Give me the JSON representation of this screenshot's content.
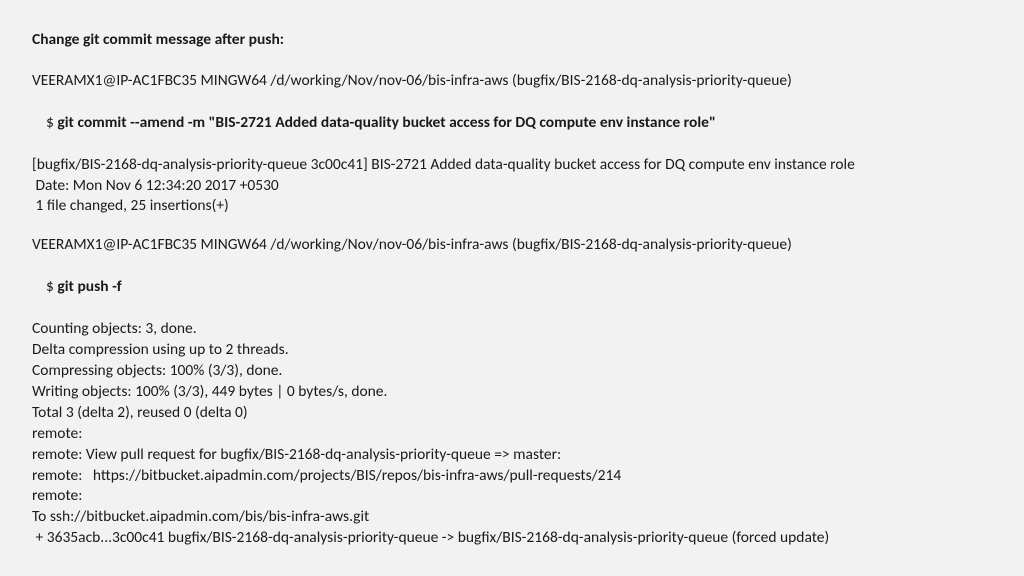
{
  "title": "Change git commit message after push:",
  "block1": {
    "prompt1": "VEERAMX1@IP-AC1FBC35 MINGW64 /d/working/Nov/nov-06/bis-infra-aws (bugfix/BIS-2168-dq-analysis-priority-queue)",
    "dollar": "$ ",
    "cmd1": "git commit --amend -m \"BIS-2721 Added data-quality bucket access for DQ compute env instance role\"",
    "out1": "[bugfix/BIS-2168-dq-analysis-priority-queue 3c00c41] BIS-2721 Added data-quality bucket access for DQ compute env instance role",
    "out2": " Date: Mon Nov 6 12:34:20 2017 +0530",
    "out3": " 1 file changed, 25 insertions(+)"
  },
  "block2": {
    "prompt2": "VEERAMX1@IP-AC1FBC35 MINGW64 /d/working/Nov/nov-06/bis-infra-aws (bugfix/BIS-2168-dq-analysis-priority-queue)",
    "dollar": "$ ",
    "cmd2": "git push -f",
    "l1": "Counting objects: 3, done.",
    "l2": "Delta compression using up to 2 threads.",
    "l3": "Compressing objects: 100% (3/3), done.",
    "l4": "Writing objects: 100% (3/3), 449 bytes | 0 bytes/s, done.",
    "l5": "Total 3 (delta 2), reused 0 (delta 0)",
    "l6": "remote:",
    "l7": "remote: View pull request for bugfix/BIS-2168-dq-analysis-priority-queue => master:",
    "l8": "remote:   https://bitbucket.aipadmin.com/projects/BIS/repos/bis-infra-aws/pull-requests/214",
    "l9": "remote:",
    "l10": "To ssh://bitbucket.aipadmin.com/bis/bis-infra-aws.git",
    "l11": " + 3635acb...3c00c41 bugfix/BIS-2168-dq-analysis-priority-queue -> bugfix/BIS-2168-dq-analysis-priority-queue (forced update)"
  }
}
